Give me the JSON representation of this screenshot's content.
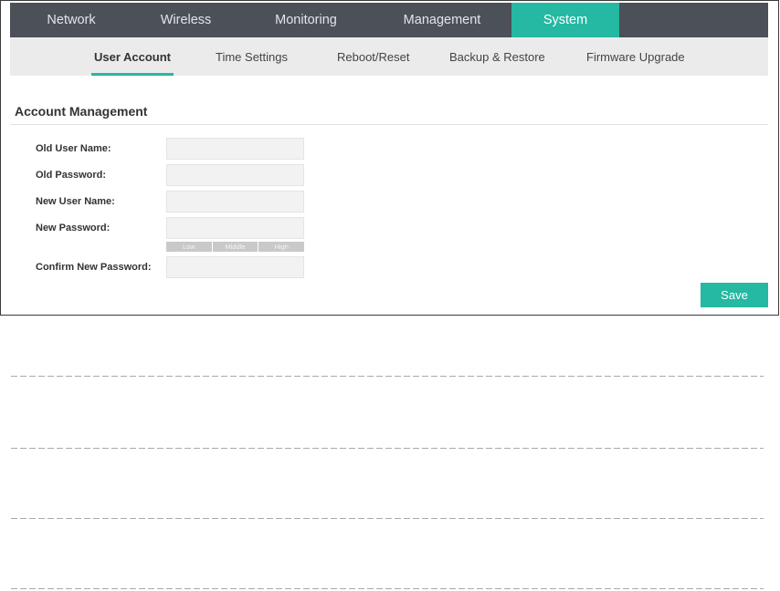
{
  "nav": {
    "tabs": [
      {
        "label": "Network",
        "active": false
      },
      {
        "label": "Wireless",
        "active": false
      },
      {
        "label": "Monitoring",
        "active": false
      },
      {
        "label": "Management",
        "active": false
      },
      {
        "label": "System",
        "active": true
      }
    ]
  },
  "subnav": {
    "items": [
      {
        "label": "User Account",
        "active": true
      },
      {
        "label": "Time Settings",
        "active": false
      },
      {
        "label": "Reboot/Reset",
        "active": false
      },
      {
        "label": "Backup & Restore",
        "active": false
      },
      {
        "label": "Firmware Upgrade",
        "active": false
      }
    ]
  },
  "section": {
    "title": "Account Management"
  },
  "form": {
    "fields": [
      {
        "label": "Old User Name:"
      },
      {
        "label": "Old Password:"
      },
      {
        "label": "New User Name:"
      },
      {
        "label": "New Password:"
      },
      {
        "label": "Confirm New Password:"
      }
    ],
    "strength_levels": [
      "Low",
      "Middle",
      "High"
    ],
    "save_label": "Save"
  },
  "colors": {
    "accent": "#25b8a2",
    "nav_background": "#4b5059",
    "subnav_background": "#ebebeb",
    "input_background": "#f2f2f2",
    "strength_bar": "#c9c9c9"
  }
}
